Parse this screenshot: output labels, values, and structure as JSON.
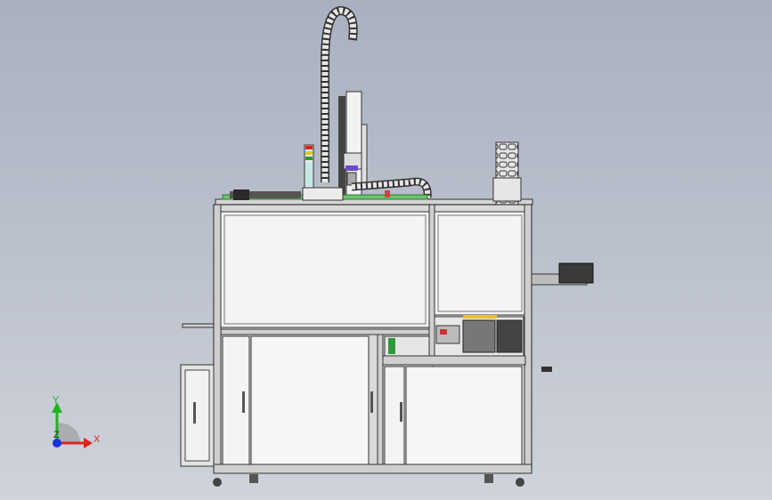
{
  "viewport": {
    "background_top": "#a9b0bf",
    "background_bottom": "#cfd3da"
  },
  "machine": {
    "frame_color": "#d9dadc",
    "panel_color": "#f4f4f4",
    "outline_color": "#3a3a3a",
    "accent_green": "#2e9a3a",
    "accent_purple": "#6a4bd0",
    "stack_light": [
      "red",
      "yellow",
      "green",
      "white"
    ]
  },
  "triad": {
    "x_label": "X",
    "y_label": "Y",
    "z_label": "Z",
    "x_color": "#e0231c",
    "y_color": "#1fb31f",
    "z_color": "#1a2fe0"
  }
}
